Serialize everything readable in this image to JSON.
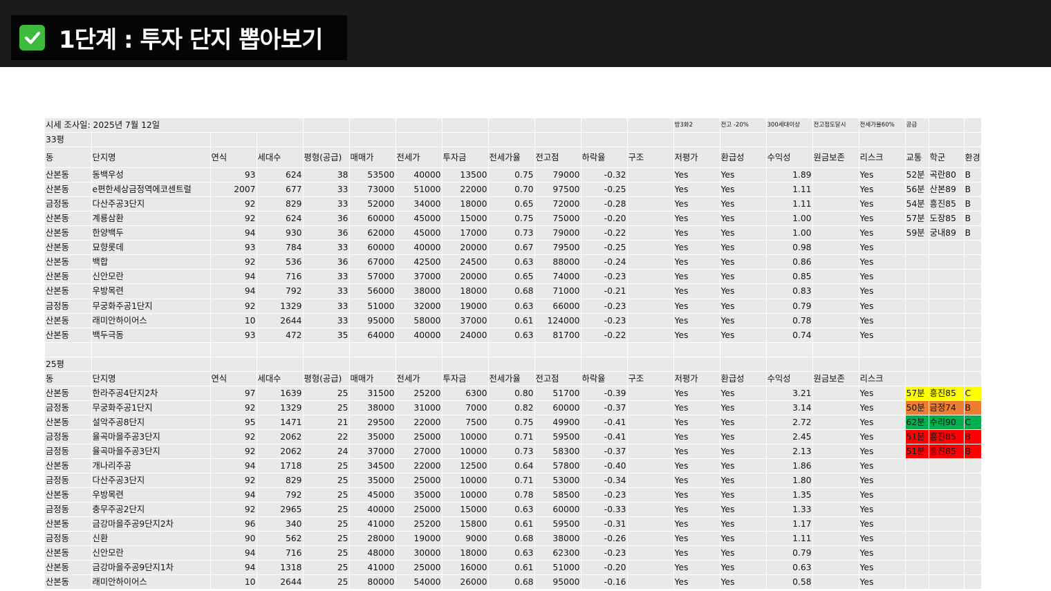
{
  "header": {
    "title": "1단계 : 투자 단지 뽑아보기"
  },
  "colors": {
    "yellow": "#ffff00",
    "orange": "#ed7d31",
    "green": "#00b050",
    "red": "#ff0000"
  },
  "sheet": {
    "survey_date": "시세 조사일: 2025년 7월 12일",
    "criteria": [
      "방3화2",
      "전고 -20%",
      "300세대이상",
      "전고점도달시",
      "전세가율60%",
      "공급"
    ],
    "sections": [
      {
        "label": "33평",
        "headers": [
          "동",
          "단지명",
          "연식",
          "세대수",
          "평형(공급)",
          "매매가",
          "전세가",
          "투자금",
          "전세가율",
          "전고점",
          "하락율",
          "구조",
          "저평가",
          "환급성",
          "수익성",
          "원금보존",
          "리스크",
          "교통",
          "학군",
          "환경"
        ],
        "rows": [
          [
            "산본동",
            "동백우성",
            "93",
            "624",
            "38",
            "53500",
            "40000",
            "13500",
            "0.75",
            "79000",
            "-0.32",
            "",
            "Yes",
            "Yes",
            "1.89",
            "",
            "Yes",
            "52분",
            "곡란80",
            "B"
          ],
          [
            "산본동",
            "e편한세상금정역에코센트럴",
            "2007",
            "677",
            "33",
            "73000",
            "51000",
            "22000",
            "0.70",
            "97500",
            "-0.25",
            "",
            "Yes",
            "Yes",
            "1.11",
            "",
            "Yes",
            "56분",
            "산본89",
            "B"
          ],
          [
            "금정동",
            "다산주공3단지",
            "92",
            "829",
            "33",
            "52000",
            "34000",
            "18000",
            "0.65",
            "72000",
            "-0.28",
            "",
            "Yes",
            "Yes",
            "1.11",
            "",
            "Yes",
            "54분",
            "흥진85",
            "B"
          ],
          [
            "산본동",
            "계룡삼환",
            "92",
            "624",
            "36",
            "60000",
            "45000",
            "15000",
            "0.75",
            "75000",
            "-0.20",
            "",
            "Yes",
            "Yes",
            "1.00",
            "",
            "Yes",
            "57분",
            "도장85",
            "B"
          ],
          [
            "산본동",
            "한양백두",
            "94",
            "930",
            "36",
            "62000",
            "45000",
            "17000",
            "0.73",
            "79000",
            "-0.22",
            "",
            "Yes",
            "Yes",
            "1.00",
            "",
            "Yes",
            "59분",
            "궁내89",
            "B"
          ],
          [
            "산본동",
            "묘향롯데",
            "93",
            "784",
            "33",
            "60000",
            "40000",
            "20000",
            "0.67",
            "79500",
            "-0.25",
            "",
            "Yes",
            "Yes",
            "0.98",
            "",
            "Yes",
            "",
            "",
            ""
          ],
          [
            "산본동",
            "백합",
            "92",
            "536",
            "36",
            "67000",
            "42500",
            "24500",
            "0.63",
            "88000",
            "-0.24",
            "",
            "Yes",
            "Yes",
            "0.86",
            "",
            "Yes",
            "",
            "",
            ""
          ],
          [
            "산본동",
            "신안모란",
            "94",
            "716",
            "33",
            "57000",
            "37000",
            "20000",
            "0.65",
            "74000",
            "-0.23",
            "",
            "Yes",
            "Yes",
            "0.85",
            "",
            "Yes",
            "",
            "",
            ""
          ],
          [
            "산본동",
            "우방목련",
            "94",
            "792",
            "33",
            "56000",
            "38000",
            "18000",
            "0.68",
            "71000",
            "-0.21",
            "",
            "Yes",
            "Yes",
            "0.83",
            "",
            "Yes",
            "",
            "",
            ""
          ],
          [
            "금정동",
            "무궁화주공1단지",
            "92",
            "1329",
            "33",
            "51000",
            "32000",
            "19000",
            "0.63",
            "66000",
            "-0.23",
            "",
            "Yes",
            "Yes",
            "0.79",
            "",
            "Yes",
            "",
            "",
            ""
          ],
          [
            "산본동",
            "래미안하이어스",
            "10",
            "2644",
            "33",
            "95000",
            "58000",
            "37000",
            "0.61",
            "124000",
            "-0.23",
            "",
            "Yes",
            "Yes",
            "0.78",
            "",
            "Yes",
            "",
            "",
            ""
          ],
          [
            "산본동",
            "백두극동",
            "93",
            "472",
            "35",
            "64000",
            "40000",
            "24000",
            "0.63",
            "81700",
            "-0.22",
            "",
            "Yes",
            "Yes",
            "0.74",
            "",
            "Yes",
            "",
            "",
            ""
          ]
        ]
      },
      {
        "label": "25평",
        "headers": [
          "동",
          "단지명",
          "연식",
          "세대수",
          "평형(공급)",
          "매매가",
          "전세가",
          "투자금",
          "전세가율",
          "전고점",
          "하락율",
          "구조",
          "저평가",
          "환급성",
          "수익성",
          "원금보존",
          "리스크",
          "",
          "",
          ""
        ],
        "rows": [
          [
            "산본동",
            "한라주공4단지2차",
            "97",
            "1639",
            "25",
            "31500",
            "25200",
            "6300",
            "0.80",
            "51700",
            "-0.39",
            "",
            "Yes",
            "Yes",
            "3.21",
            "",
            "Yes",
            "57분",
            "흥진85",
            "C"
          ],
          [
            "금정동",
            "무궁화주공1단지",
            "92",
            "1329",
            "25",
            "38000",
            "31000",
            "7000",
            "0.82",
            "60000",
            "-0.37",
            "",
            "Yes",
            "Yes",
            "3.14",
            "",
            "Yes",
            "50분",
            "금정74",
            "B"
          ],
          [
            "산본동",
            "설악주공8단지",
            "95",
            "1471",
            "21",
            "29500",
            "22000",
            "7500",
            "0.75",
            "49900",
            "-0.41",
            "",
            "Yes",
            "Yes",
            "2.72",
            "",
            "Yes",
            "62분",
            "수리90",
            "C"
          ],
          [
            "금정동",
            "율곡마을주공3단지",
            "92",
            "2062",
            "22",
            "35000",
            "25000",
            "10000",
            "0.71",
            "59500",
            "-0.41",
            "",
            "Yes",
            "Yes",
            "2.45",
            "",
            "Yes",
            "51분",
            "흥진85",
            "B"
          ],
          [
            "금정동",
            "율곡마을주공3단지",
            "92",
            "2062",
            "24",
            "37000",
            "27000",
            "10000",
            "0.73",
            "58300",
            "-0.37",
            "",
            "Yes",
            "Yes",
            "2.13",
            "",
            "Yes",
            "51분",
            "흥진85",
            "B"
          ],
          [
            "산본동",
            "개나리주공",
            "94",
            "1718",
            "25",
            "34500",
            "22000",
            "12500",
            "0.64",
            "57800",
            "-0.40",
            "",
            "Yes",
            "Yes",
            "1.86",
            "",
            "Yes",
            "",
            "",
            ""
          ],
          [
            "금정동",
            "다산주공3단지",
            "92",
            "829",
            "25",
            "35000",
            "25000",
            "10000",
            "0.71",
            "53000",
            "-0.34",
            "",
            "Yes",
            "Yes",
            "1.80",
            "",
            "Yes",
            "",
            "",
            ""
          ],
          [
            "산본동",
            "우방목련",
            "94",
            "792",
            "25",
            "45000",
            "35000",
            "10000",
            "0.78",
            "58500",
            "-0.23",
            "",
            "Yes",
            "Yes",
            "1.35",
            "",
            "Yes",
            "",
            "",
            ""
          ],
          [
            "금정동",
            "충무주공2단지",
            "92",
            "2965",
            "25",
            "40000",
            "25000",
            "15000",
            "0.63",
            "60000",
            "-0.33",
            "",
            "Yes",
            "Yes",
            "1.33",
            "",
            "Yes",
            "",
            "",
            ""
          ],
          [
            "산본동",
            "금강마을주공9단지2차",
            "96",
            "340",
            "25",
            "41000",
            "25200",
            "15800",
            "0.61",
            "59500",
            "-0.31",
            "",
            "Yes",
            "Yes",
            "1.17",
            "",
            "Yes",
            "",
            "",
            ""
          ],
          [
            "금정동",
            "신환",
            "90",
            "562",
            "25",
            "28000",
            "19000",
            "9000",
            "0.68",
            "38000",
            "-0.26",
            "",
            "Yes",
            "Yes",
            "1.11",
            "",
            "Yes",
            "",
            "",
            ""
          ],
          [
            "산본동",
            "신안모란",
            "94",
            "716",
            "25",
            "48000",
            "30000",
            "18000",
            "0.63",
            "62300",
            "-0.23",
            "",
            "Yes",
            "Yes",
            "0.79",
            "",
            "Yes",
            "",
            "",
            ""
          ],
          [
            "산본동",
            "금강마을주공9단지1차",
            "94",
            "1318",
            "25",
            "41000",
            "25000",
            "16000",
            "0.61",
            "51000",
            "-0.20",
            "",
            "Yes",
            "Yes",
            "0.63",
            "",
            "Yes",
            "",
            "",
            ""
          ],
          [
            "산본동",
            "래미안하이어스",
            "10",
            "2644",
            "25",
            "80000",
            "54000",
            "26000",
            "0.68",
            "95000",
            "-0.16",
            "",
            "Yes",
            "Yes",
            "0.58",
            "",
            "Yes",
            "",
            "",
            ""
          ]
        ],
        "highlights": [
          "yellow",
          "orange",
          "green",
          "red",
          "red"
        ]
      }
    ]
  }
}
